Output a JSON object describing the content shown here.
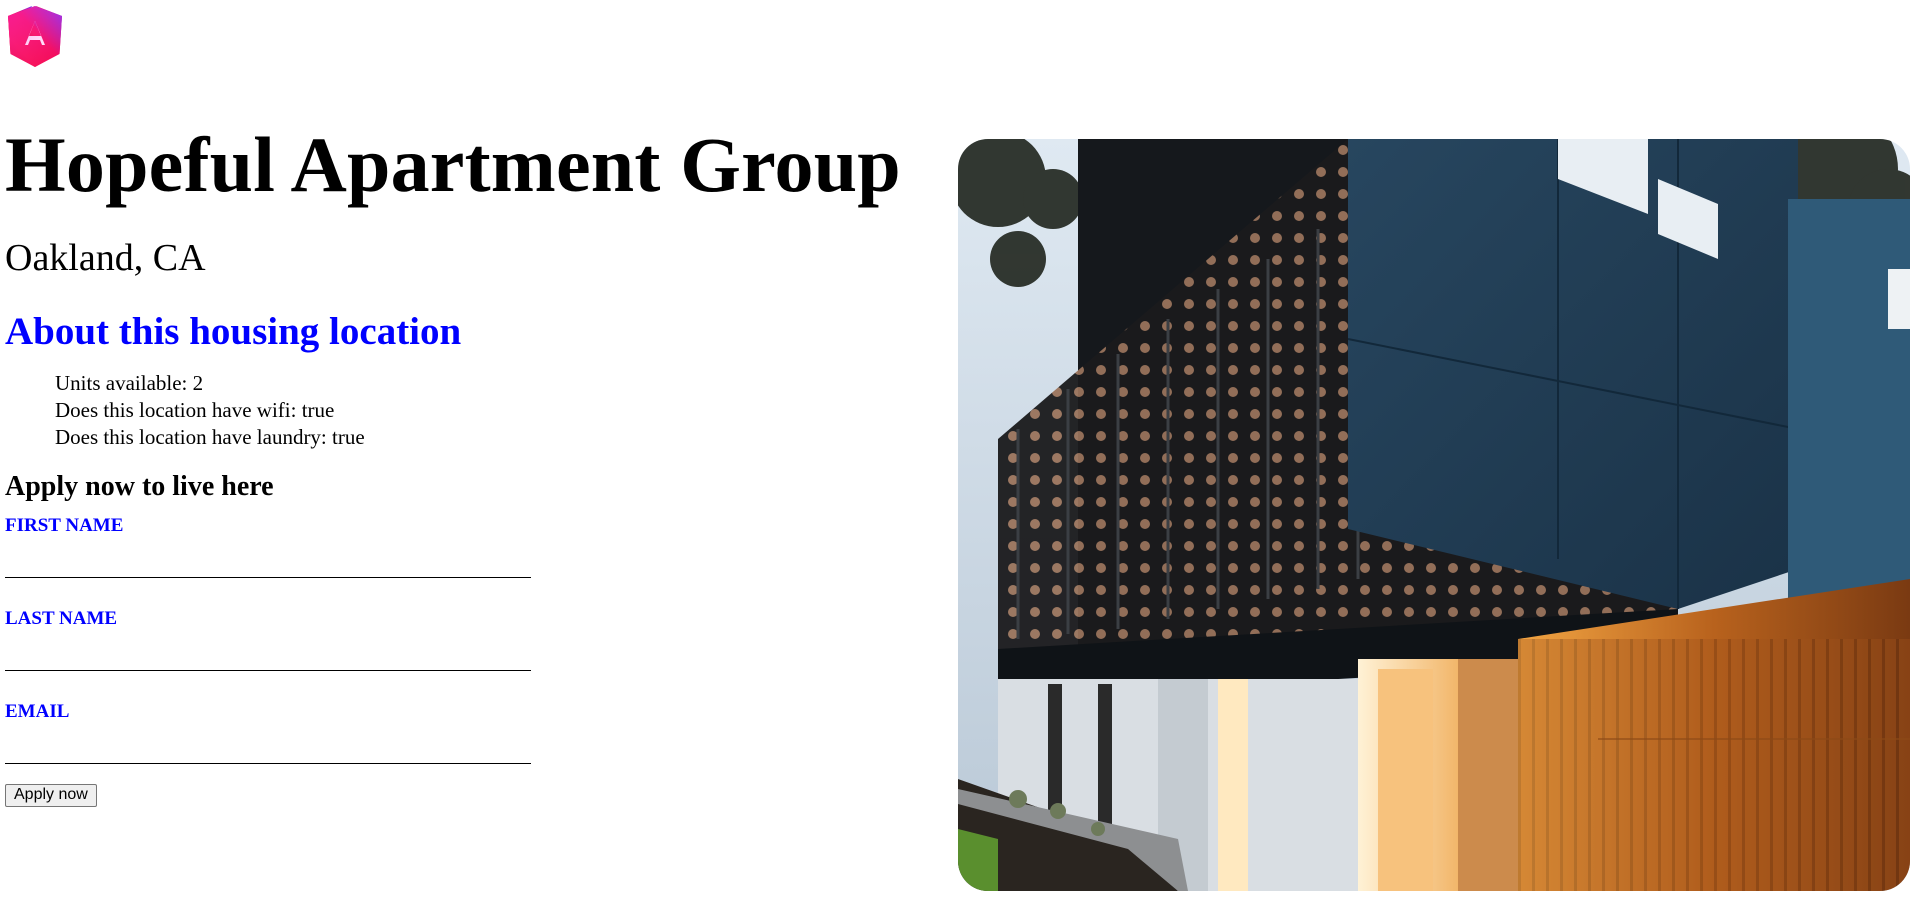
{
  "header": {
    "logo_icon": "angular-logo-icon",
    "logo_colors": [
      "#e40035",
      "#f60a48",
      "#c800c8",
      "#7b2ff7"
    ]
  },
  "listing": {
    "title": "Hopeful Apartment Group",
    "location": "Oakland, CA",
    "about_heading": "About this housing location",
    "features": [
      "Units available: 2",
      "Does this location have wifi: true",
      "Does this location have laundry: true"
    ],
    "photo_icon": "building-photo"
  },
  "form": {
    "heading": "Apply now to live here",
    "first_name_label": "FIRST NAME",
    "first_name_value": "",
    "last_name_label": "LAST NAME",
    "last_name_value": "",
    "email_label": "EMAIL",
    "email_value": "",
    "submit_label": "Apply now"
  },
  "colors": {
    "accent": "#0000ff",
    "text": "#000000",
    "background": "#ffffff"
  }
}
